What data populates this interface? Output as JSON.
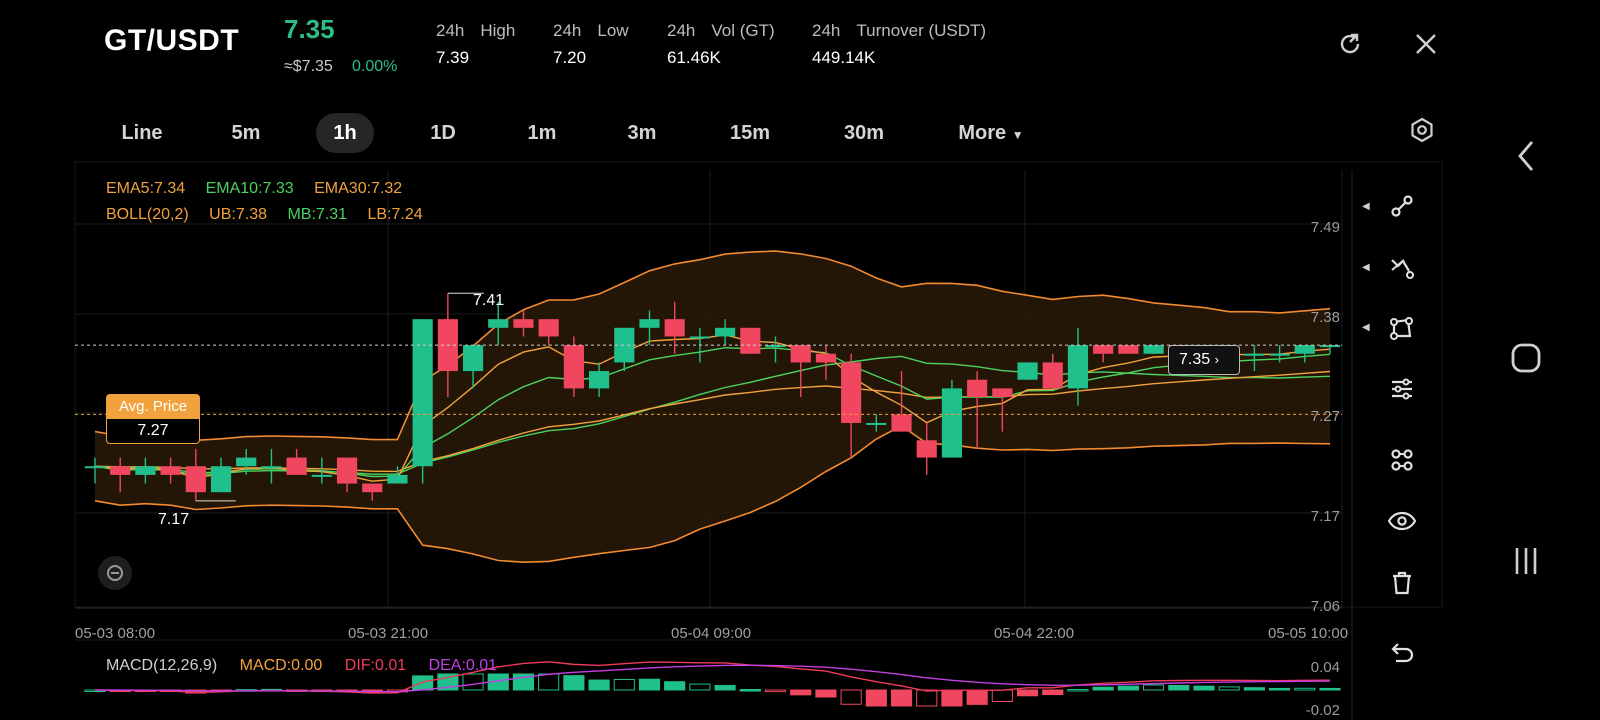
{
  "header": {
    "pair": "GT/USDT",
    "last_price": "7.35",
    "price_usd": "≈$7.35",
    "price_change": "0.00%",
    "stats": [
      {
        "prefix": "24h",
        "label": "High",
        "value": "7.39"
      },
      {
        "prefix": "24h",
        "label": "Low",
        "value": "7.20"
      },
      {
        "prefix": "24h",
        "label": "Vol (GT)",
        "value": "61.46K"
      },
      {
        "prefix": "24h",
        "label": "Turnover (USDT)",
        "value": "449.14K"
      }
    ],
    "icons": [
      "refresh-icon",
      "close-icon"
    ]
  },
  "timeframes": {
    "items": [
      "Line",
      "5m",
      "1h",
      "1D",
      "1m",
      "3m",
      "15m",
      "30m",
      "More"
    ],
    "active": "1h"
  },
  "indicators": {
    "ema5": "EMA5:7.34",
    "ema10": "EMA10:7.33",
    "ema30": "EMA30:7.32",
    "boll": "BOLL(20,2)",
    "ub": "UB:7.38",
    "mb": "MB:7.31",
    "lb": "LB:7.24"
  },
  "chart_labels": {
    "high_marker": "7.41",
    "low_marker": "7.17",
    "avg_price_label": "Avg. Price",
    "avg_price_value": "7.27",
    "current_tag": "7.35"
  },
  "colors": {
    "up": "#1fc08c",
    "down": "#f0465f",
    "ema5": "#f2a23c",
    "ema10": "#4cd25f",
    "ema30": "#f2a23c",
    "boll": "#f28a30",
    "dif": "#ef3b5b",
    "dea": "#c040e0",
    "accent": "#2ebd85"
  },
  "yaxis": [
    "7.49",
    "7.38",
    "7.27",
    "7.17",
    "7.06"
  ],
  "xaxis": [
    "05-03 08:00",
    "05-03 21:00",
    "05-04 09:00",
    "05-04 22:00",
    "05-05 10:00"
  ],
  "macd": {
    "title": "MACD(12,26,9)",
    "macd": "MACD:0.00",
    "dif": "DIF:0.01",
    "dea": "DEA:0.01",
    "yaxis": [
      "0.04",
      "-0.02"
    ]
  },
  "chart_data": {
    "type": "candlestick",
    "ylim": [
      7.06,
      7.49
    ],
    "candles": [
      {
        "o": 7.21,
        "h": 7.22,
        "l": 7.19,
        "c": 7.21
      },
      {
        "o": 7.21,
        "h": 7.22,
        "l": 7.18,
        "c": 7.2
      },
      {
        "o": 7.2,
        "h": 7.22,
        "l": 7.19,
        "c": 7.21
      },
      {
        "o": 7.21,
        "h": 7.22,
        "l": 7.19,
        "c": 7.2
      },
      {
        "o": 7.21,
        "h": 7.23,
        "l": 7.17,
        "c": 7.18
      },
      {
        "o": 7.18,
        "h": 7.22,
        "l": 7.18,
        "c": 7.21
      },
      {
        "o": 7.21,
        "h": 7.23,
        "l": 7.2,
        "c": 7.22
      },
      {
        "o": 7.21,
        "h": 7.23,
        "l": 7.19,
        "c": 7.21
      },
      {
        "o": 7.22,
        "h": 7.23,
        "l": 7.2,
        "c": 7.2
      },
      {
        "o": 7.2,
        "h": 7.22,
        "l": 7.19,
        "c": 7.2
      },
      {
        "o": 7.22,
        "h": 7.22,
        "l": 7.18,
        "c": 7.19
      },
      {
        "o": 7.19,
        "h": 7.19,
        "l": 7.17,
        "c": 7.18
      },
      {
        "o": 7.19,
        "h": 7.21,
        "l": 7.19,
        "c": 7.2
      },
      {
        "o": 7.21,
        "h": 7.38,
        "l": 7.19,
        "c": 7.38
      },
      {
        "o": 7.38,
        "h": 7.41,
        "l": 7.29,
        "c": 7.32
      },
      {
        "o": 7.32,
        "h": 7.35,
        "l": 7.3,
        "c": 7.35
      },
      {
        "o": 7.37,
        "h": 7.4,
        "l": 7.35,
        "c": 7.38
      },
      {
        "o": 7.38,
        "h": 7.39,
        "l": 7.36,
        "c": 7.37
      },
      {
        "o": 7.38,
        "h": 7.38,
        "l": 7.35,
        "c": 7.36
      },
      {
        "o": 7.35,
        "h": 7.36,
        "l": 7.29,
        "c": 7.3
      },
      {
        "o": 7.3,
        "h": 7.33,
        "l": 7.29,
        "c": 7.32
      },
      {
        "o": 7.33,
        "h": 7.37,
        "l": 7.32,
        "c": 7.37
      },
      {
        "o": 7.37,
        "h": 7.39,
        "l": 7.35,
        "c": 7.38
      },
      {
        "o": 7.38,
        "h": 7.4,
        "l": 7.34,
        "c": 7.36
      },
      {
        "o": 7.36,
        "h": 7.37,
        "l": 7.33,
        "c": 7.36
      },
      {
        "o": 7.36,
        "h": 7.38,
        "l": 7.35,
        "c": 7.37
      },
      {
        "o": 7.37,
        "h": 7.37,
        "l": 7.34,
        "c": 7.34
      },
      {
        "o": 7.35,
        "h": 7.36,
        "l": 7.33,
        "c": 7.35
      },
      {
        "o": 7.35,
        "h": 7.35,
        "l": 7.29,
        "c": 7.33
      },
      {
        "o": 7.34,
        "h": 7.35,
        "l": 7.31,
        "c": 7.33
      },
      {
        "o": 7.33,
        "h": 7.34,
        "l": 7.22,
        "c": 7.26
      },
      {
        "o": 7.26,
        "h": 7.27,
        "l": 7.25,
        "c": 7.26
      },
      {
        "o": 7.27,
        "h": 7.32,
        "l": 7.25,
        "c": 7.25
      },
      {
        "o": 7.24,
        "h": 7.26,
        "l": 7.2,
        "c": 7.22
      },
      {
        "o": 7.22,
        "h": 7.31,
        "l": 7.22,
        "c": 7.3
      },
      {
        "o": 7.31,
        "h": 7.32,
        "l": 7.23,
        "c": 7.29
      },
      {
        "o": 7.3,
        "h": 7.3,
        "l": 7.25,
        "c": 7.29
      },
      {
        "o": 7.31,
        "h": 7.33,
        "l": 7.31,
        "c": 7.33
      },
      {
        "o": 7.33,
        "h": 7.34,
        "l": 7.31,
        "c": 7.3
      },
      {
        "o": 7.3,
        "h": 7.37,
        "l": 7.28,
        "c": 7.35
      },
      {
        "o": 7.35,
        "h": 7.35,
        "l": 7.33,
        "c": 7.34
      },
      {
        "o": 7.35,
        "h": 7.35,
        "l": 7.34,
        "c": 7.34
      },
      {
        "o": 7.34,
        "h": 7.35,
        "l": 7.34,
        "c": 7.35
      },
      {
        "o": 7.35,
        "h": 7.35,
        "l": 7.34,
        "c": 7.34
      },
      {
        "o": 7.34,
        "h": 7.35,
        "l": 7.33,
        "c": 7.34
      },
      {
        "o": 7.34,
        "h": 7.35,
        "l": 7.33,
        "c": 7.34
      },
      {
        "o": 7.34,
        "h": 7.35,
        "l": 7.32,
        "c": 7.34
      },
      {
        "o": 7.34,
        "h": 7.35,
        "l": 7.33,
        "c": 7.34
      },
      {
        "o": 7.34,
        "h": 7.35,
        "l": 7.33,
        "c": 7.35
      },
      {
        "o": 7.35,
        "h": 7.35,
        "l": 7.34,
        "c": 7.35
      }
    ],
    "current_price": 7.35,
    "avg_price": 7.27
  },
  "toolbar": {
    "icons": [
      "trend-line-icon",
      "fork-line-icon",
      "shape-icon",
      "indicator-settings-icon",
      "layers-icon",
      "eye-icon",
      "trash-icon",
      "undo-icon"
    ]
  },
  "nav": {
    "icons": [
      "back-icon",
      "home-icon",
      "recent-apps-icon"
    ]
  }
}
